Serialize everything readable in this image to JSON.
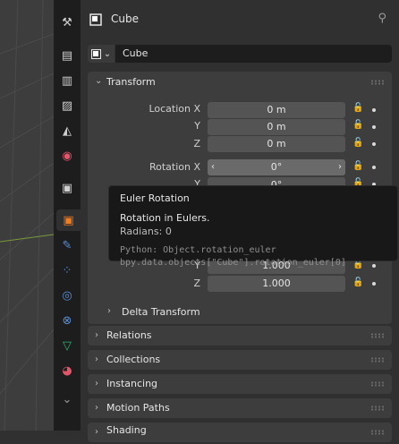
{
  "header": {
    "title": "Cube",
    "pin_icon": "pin-icon"
  },
  "name_field": {
    "value": "Cube",
    "mode_icon": "object-cube-icon"
  },
  "tabs": [
    {
      "icon": "tool-icon",
      "glyph": "⚒"
    },
    {
      "icon": "render-icon",
      "glyph": "📷"
    },
    {
      "icon": "output-icon",
      "glyph": "🖶"
    },
    {
      "icon": "view-layer-icon",
      "glyph": "🖼"
    },
    {
      "icon": "scene-icon",
      "glyph": "◭"
    },
    {
      "icon": "world-icon",
      "glyph": "◉"
    },
    {
      "icon": "collection-icon",
      "glyph": "▣"
    },
    {
      "icon": "object-icon",
      "glyph": "■"
    },
    {
      "icon": "modifier-icon",
      "glyph": "🔧"
    },
    {
      "icon": "particles-icon",
      "glyph": "⁘"
    },
    {
      "icon": "physics-icon",
      "glyph": "◎"
    },
    {
      "icon": "constraints-icon",
      "glyph": "⛓"
    },
    {
      "icon": "data-icon",
      "glyph": "▽"
    },
    {
      "icon": "material-icon",
      "glyph": "◕"
    },
    {
      "icon": "more-icon",
      "glyph": "⌄"
    }
  ],
  "transform": {
    "title": "Transform",
    "location": {
      "label": "Location X",
      "y_label": "Y",
      "z_label": "Z",
      "x": "0 m",
      "y": "0 m",
      "z": "0 m"
    },
    "rotation": {
      "label": "Rotation X",
      "y_label": "Y",
      "x": "0°",
      "y": "0°"
    },
    "scale": {
      "y_label": "Y",
      "z_label": "Z",
      "y": "1.000",
      "z": "1.000"
    },
    "delta": "Delta Transform"
  },
  "tooltip": {
    "title": "Euler Rotation",
    "description": "Rotation in Eulers.",
    "value": "Radians: 0",
    "python1": "Python: Object.rotation_euler",
    "python2": "bpy.data.objects[\"Cube\"].rotation_euler[0]"
  },
  "panels": [
    "Relations",
    "Collections",
    "Instancing",
    "Motion Paths",
    "Shading"
  ],
  "colors": {
    "active_tab": "#303030",
    "object_orange": "#ef7d22",
    "modifier_blue": "#5b8fd6",
    "physics_blue": "#3c74c8",
    "data_green": "#2bb673",
    "material_red": "#e0566b"
  }
}
